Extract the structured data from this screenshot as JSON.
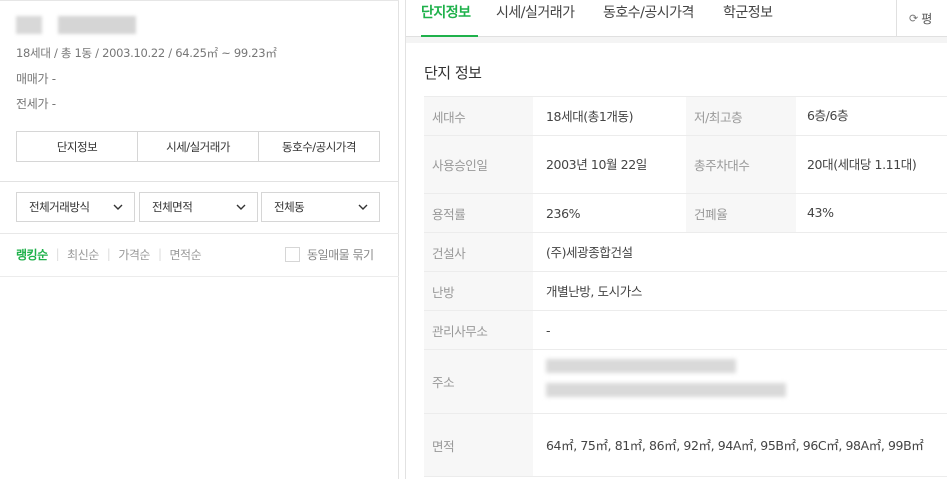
{
  "left": {
    "summary": "18세대 / 총 1동 / 2003.10.22 / 64.25㎡ ~ 99.23㎡",
    "sale_price": "매매가 -",
    "jeonse_price": "전세가 -",
    "tabs": [
      "단지정보",
      "시세/실거래가",
      "동호수/공시가격"
    ],
    "filters": [
      "전체거래방식",
      "전체면적",
      "전체동"
    ],
    "sort": [
      "랭킹순",
      "최신순",
      "가격순",
      "면적순"
    ],
    "same_listing": "동일매물 묶기"
  },
  "right": {
    "tabs": [
      "단지정보",
      "시세/실거래가",
      "동호수/공시가격",
      "학군정보"
    ],
    "refresh_label": "평",
    "section_title": "단지 정보",
    "info": {
      "households_label": "세대수",
      "households": "18세대(총1개동)",
      "floors_label": "저/최고층",
      "floors": "6층/6층",
      "approval_label": "사용승인일",
      "approval": "2003년 10월 22일",
      "parking_label": "총주차대수",
      "parking": "20대(세대당 1.11대)",
      "far_label": "용적률",
      "far": "236%",
      "bcr_label": "건폐율",
      "bcr": "43%",
      "builder_label": "건설사",
      "builder": "(주)세광종합건설",
      "heating_label": "난방",
      "heating": "개별난방, 도시가스",
      "office_label": "관리사무소",
      "office": "-",
      "address_label": "주소",
      "area_label": "면적",
      "area": "64㎡, 75㎡, 81㎡, 86㎡, 92㎡, 94A㎡, 95B㎡, 96C㎡, 98A㎡, 99B㎡"
    }
  },
  "colors": {
    "accent": "#1fb14b"
  }
}
